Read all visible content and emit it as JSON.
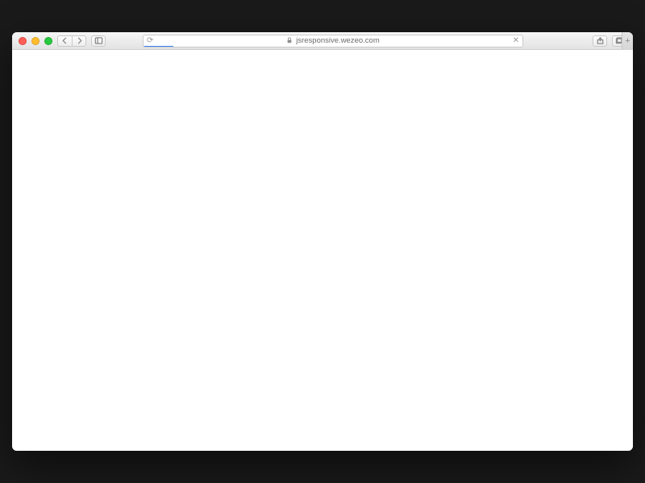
{
  "browser": {
    "url_display": "jsresponsive.wezeo.com",
    "secure": true,
    "loading": true
  }
}
